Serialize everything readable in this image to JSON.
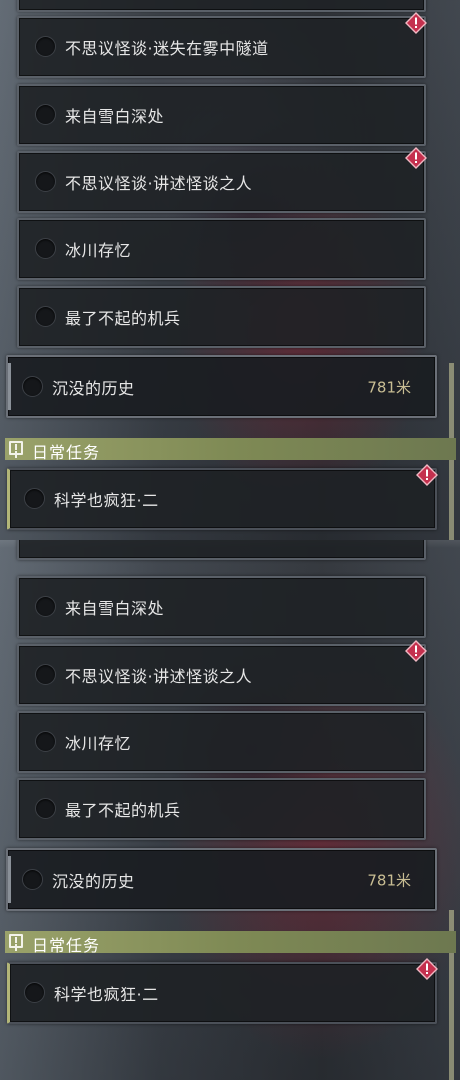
{
  "quests": [
    {
      "name": "不思议怪谈·迷失在雾中隧道",
      "alert": true
    },
    {
      "name": "来自雪白深处",
      "alert": false
    },
    {
      "name": "不思议怪谈·讲述怪谈之人",
      "alert": true
    },
    {
      "name": "冰川存忆",
      "alert": false
    },
    {
      "name": "最了不起的机兵",
      "alert": false
    }
  ],
  "selected_quest": {
    "name": "沉没的历史",
    "distance": "781米"
  },
  "daily_section": {
    "title": "日常任务",
    "quests": [
      {
        "name": "科学也疯狂·二",
        "alert": true
      }
    ]
  },
  "colors": {
    "header_bar": "#9aa26a",
    "alert_badge": "#c4304e",
    "distance_text": "#c8bd93"
  },
  "icons": {
    "alert": "exclamation-diamond-icon",
    "status": "circle-indicator-icon",
    "daily_header": "exclamation-box-icon"
  }
}
